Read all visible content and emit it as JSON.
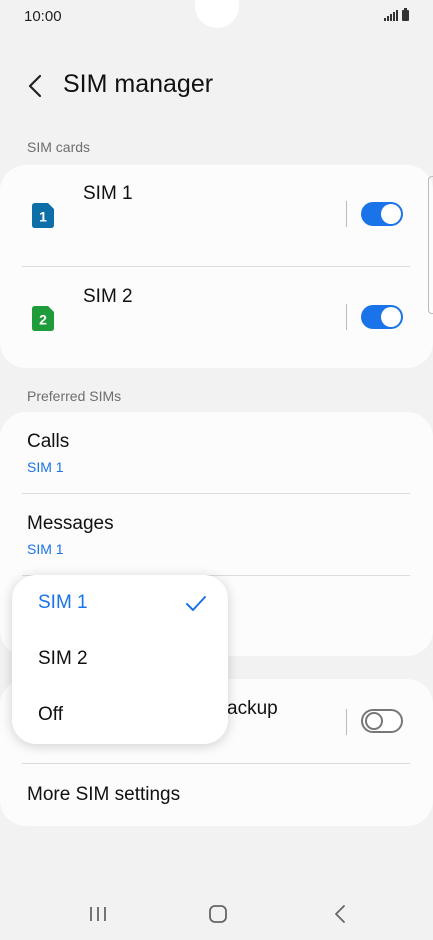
{
  "status": {
    "time": "10:00"
  },
  "header": {
    "title": "SIM manager",
    "back_icon": "back-arrow-icon"
  },
  "sim_cards": {
    "section_label": "SIM cards",
    "items": [
      {
        "name": "SIM 1",
        "badge": "1",
        "badge_color": "#0d6ea8",
        "enabled": true
      },
      {
        "name": "SIM 2",
        "badge": "2",
        "badge_color": "#1e9b3b",
        "enabled": true
      }
    ]
  },
  "preferred": {
    "section_label": "Preferred SIMs",
    "items": [
      {
        "title": "Calls",
        "value": "SIM 1"
      },
      {
        "title": "Messages",
        "value": "SIM 1"
      }
    ]
  },
  "backup": {
    "title_visible_fragment": "ackup",
    "enabled": false
  },
  "more_settings": {
    "label": "More SIM settings"
  },
  "dropdown": {
    "options": [
      "SIM 1",
      "SIM 2",
      "Off"
    ],
    "selected": "SIM 1"
  },
  "colors": {
    "accent": "#1a73e8",
    "background": "#f2f2f2",
    "card": "#fcfcfc"
  }
}
